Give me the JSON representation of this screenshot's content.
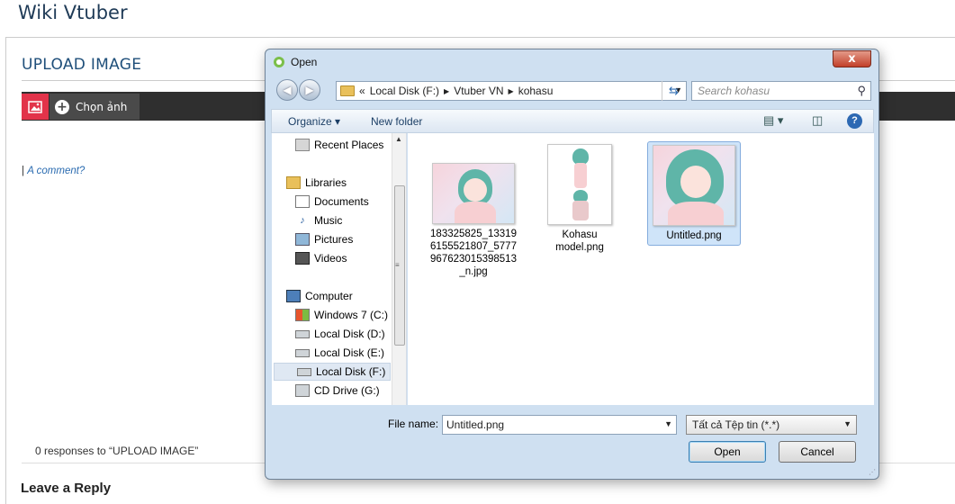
{
  "site": {
    "title": "Wiki Vtuber"
  },
  "page": {
    "title": "UPLOAD IMAGE",
    "choose_button": "Chọn ảnh",
    "comment_prefix": "|",
    "comment_link": "A comment?",
    "responses": "0 responses to “UPLOAD IMAGE”",
    "leave_reply": "Leave a Reply"
  },
  "dialog": {
    "title": "Open",
    "close_label": "x",
    "address": {
      "prefix": "«",
      "crumbs": [
        "Local Disk (F:)",
        "Vtuber VN",
        "kohasu"
      ]
    },
    "search_placeholder": "Search kohasu",
    "toolbar": {
      "organize": "Organize ▾",
      "new_folder": "New folder"
    },
    "nav": {
      "recent_places": "Recent Places",
      "libraries": "Libraries",
      "documents": "Documents",
      "music": "Music",
      "pictures": "Pictures",
      "videos": "Videos",
      "computer": "Computer",
      "drive_c": "Windows 7  (C:)",
      "drive_d": "Local Disk (D:)",
      "drive_e": "Local Disk (E:)",
      "drive_f": "Local Disk (F:)",
      "drive_g": "CD Drive (G:)"
    },
    "files": {
      "file1": "183325825_133196155521807_5777967623015398513_n.jpg",
      "file1_lines": [
        "183325825_13319",
        "6155521807_5777",
        "967623015398513",
        "_n.jpg"
      ],
      "file2_lines": [
        "Kohasu",
        "model.png"
      ],
      "file3": "Untitled.png"
    },
    "file_name_label": "File name:",
    "file_name_value": "Untitled.png",
    "file_type_value": "Tất cả Tệp tin (*.*)",
    "open_button": "Open",
    "cancel_button": "Cancel"
  },
  "colors": {
    "image_button": "#e2334a",
    "toolbar": "#2f2f2f",
    "link": "#2a6bb0"
  }
}
